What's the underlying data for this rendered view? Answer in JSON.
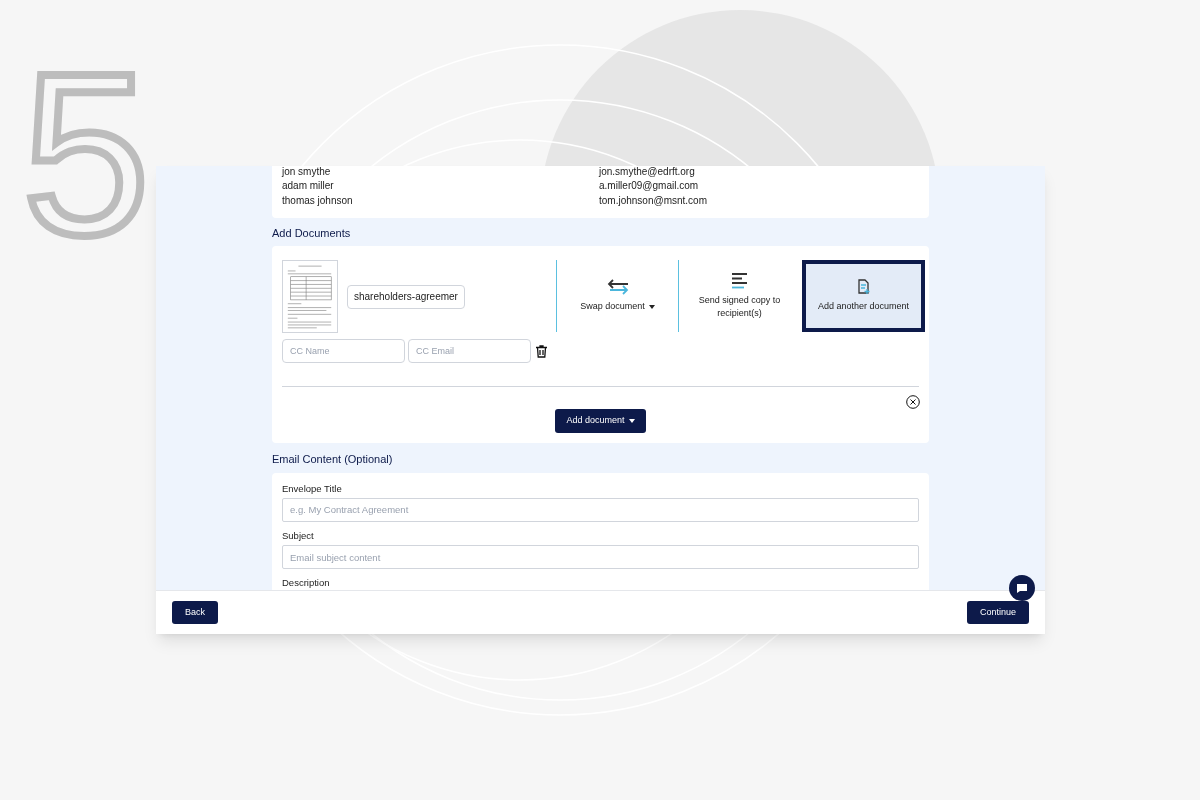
{
  "step_number": "5",
  "recipients": [
    {
      "name": "jon smythe",
      "email": "jon.smythe@edrft.org"
    },
    {
      "name": "adam miller",
      "email": "a.miller09@gmail.com"
    },
    {
      "name": "thomas johnson",
      "email": "tom.johnson@msnt.com"
    }
  ],
  "documents_section": {
    "title": "Add Documents",
    "file_name": "shareholders-agreemer",
    "actions": [
      {
        "label": "Swap document",
        "kind": "swap",
        "selected": false
      },
      {
        "label": "Send signed copy to recipient(s)",
        "kind": "send",
        "selected": false
      },
      {
        "label": "Add another document",
        "kind": "add",
        "selected": true
      }
    ],
    "cc": {
      "name_placeholder": "CC Name",
      "email_placeholder": "CC Email"
    },
    "add_button": "Add document"
  },
  "email_section": {
    "title": "Email Content (Optional)",
    "fields": [
      {
        "label": "Envelope Title",
        "placeholder": "e.g. My Contract Agreement"
      },
      {
        "label": "Subject",
        "placeholder": "Email subject content"
      },
      {
        "label": "Description"
      }
    ]
  },
  "footer": {
    "back": "Back",
    "continue": "Continue"
  }
}
